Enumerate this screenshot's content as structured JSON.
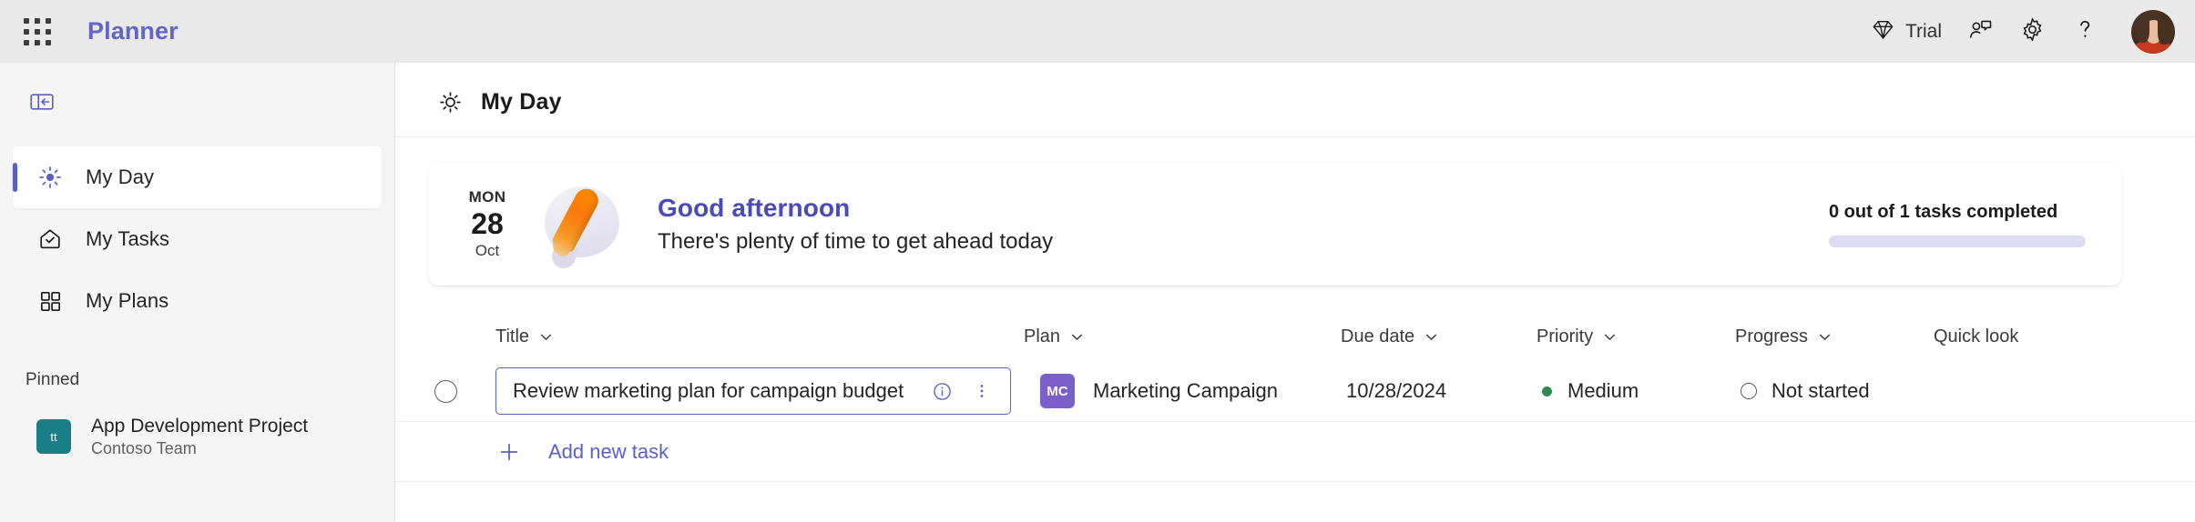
{
  "topbar": {
    "app_launcher_icon": "waffle-grid-icon",
    "brand": "Planner",
    "trial_label": "Trial",
    "trial_icon": "diamond-icon",
    "feedback_icon": "person-chat-icon",
    "settings_icon": "gear-icon",
    "help_icon": "question-mark-icon",
    "avatar_icon": "user-avatar"
  },
  "sidebar": {
    "collapse_icon": "panel-collapse-left-icon",
    "items": [
      {
        "label": "My Day",
        "icon": "sun-icon",
        "active": true
      },
      {
        "label": "My Tasks",
        "icon": "tasks-home-check-icon",
        "active": false
      },
      {
        "label": "My Plans",
        "icon": "grid-four-squares-icon",
        "active": false
      }
    ],
    "pinned_header": "Pinned",
    "pinned": [
      {
        "title": "App Development Project",
        "subtitle": "Contoso Team",
        "initials": "tt",
        "color": "#197e86"
      }
    ]
  },
  "page": {
    "icon": "sun-icon",
    "title": "My Day"
  },
  "banner": {
    "date": {
      "dow": "MON",
      "day": "28",
      "month": "Oct"
    },
    "art_icon": "pencil-illustration",
    "greeting": "Good afternoon",
    "subtitle": "There's plenty of time to get ahead today",
    "progress_label": "0 out of 1 tasks completed",
    "progress_percent": 0,
    "progress_fill_color": "#5b5fc7",
    "progress_track_color": "#dcdcf5"
  },
  "table": {
    "columns": [
      {
        "key": "title",
        "label": "Title",
        "sortable": true
      },
      {
        "key": "plan",
        "label": "Plan",
        "sortable": true
      },
      {
        "key": "due",
        "label": "Due date",
        "sortable": true
      },
      {
        "key": "priority",
        "label": "Priority",
        "sortable": true
      },
      {
        "key": "progress",
        "label": "Progress",
        "sortable": true
      },
      {
        "key": "quicklook",
        "label": "Quick look",
        "sortable": false
      }
    ],
    "rows": [
      {
        "completed": false,
        "title": "Review marketing plan for campaign budget",
        "title_focused": true,
        "info_icon": "info-circle-icon",
        "more_icon": "more-vertical-icon",
        "plan_initials": "MC",
        "plan_badge_color": "#7b5fc9",
        "plan_name": "Marketing Campaign",
        "due_date": "10/28/2024",
        "priority": "Medium",
        "priority_color": "#2e8b4f",
        "progress": "Not started",
        "quick_look": ""
      }
    ],
    "add_task": {
      "label": "Add new task",
      "icon": "plus-icon"
    }
  }
}
